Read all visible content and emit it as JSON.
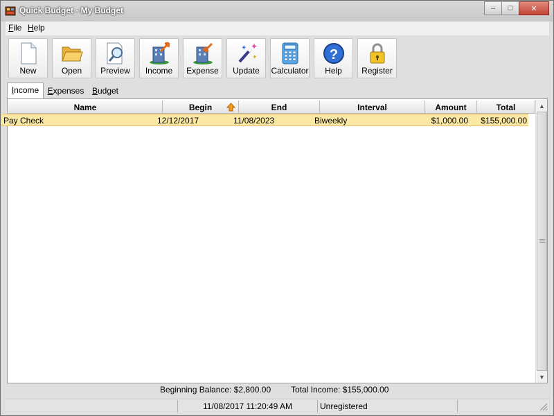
{
  "window": {
    "title": "Quick Budget - My Budget"
  },
  "controls": {
    "minimize": "–",
    "maximize": "□",
    "close": "✕"
  },
  "menu": [
    {
      "pre": "",
      "u": "F",
      "post": "ile"
    },
    {
      "pre": "",
      "u": "H",
      "post": "elp"
    }
  ],
  "toolbar": [
    {
      "label": "New",
      "icon": "new-document-icon"
    },
    {
      "label": "Open",
      "icon": "open-folder-icon"
    },
    {
      "label": "Preview",
      "icon": "preview-magnifier-icon"
    },
    {
      "label": "Income",
      "icon": "income-building-icon"
    },
    {
      "label": "Expense",
      "icon": "expense-building-icon"
    },
    {
      "label": "Update",
      "icon": "magic-wand-icon"
    },
    {
      "label": "Calculator",
      "icon": "calculator-icon"
    },
    {
      "label": "Help",
      "icon": "help-icon"
    },
    {
      "label": "Register",
      "icon": "padlock-icon"
    }
  ],
  "tabs": [
    {
      "pre": "",
      "u": "I",
      "post": "ncome",
      "active": true
    },
    {
      "pre": "",
      "u": "E",
      "post": "xpenses",
      "active": false
    },
    {
      "pre": "",
      "u": "B",
      "post": "udget",
      "active": false
    }
  ],
  "grid": {
    "columns": [
      "Name",
      "Begin",
      "End",
      "Interval",
      "Amount",
      "Total"
    ],
    "sorted_column": "Begin",
    "rows": [
      {
        "name": "Pay Check",
        "begin": "12/12/2017",
        "end": "11/08/2023",
        "interval": "Biweekly",
        "amount": "$1,000.00",
        "total": "$155,000.00"
      }
    ]
  },
  "summary": {
    "beginning_balance": "Beginning Balance: $2,800.00",
    "total_income": "Total Income: $155,000.00"
  },
  "status": {
    "datetime": "11/08/2017 11:20:49 AM",
    "registration": "Unregistered"
  },
  "colors": {
    "selected_row": "#fbe8a5",
    "close_button": "#c24535"
  }
}
